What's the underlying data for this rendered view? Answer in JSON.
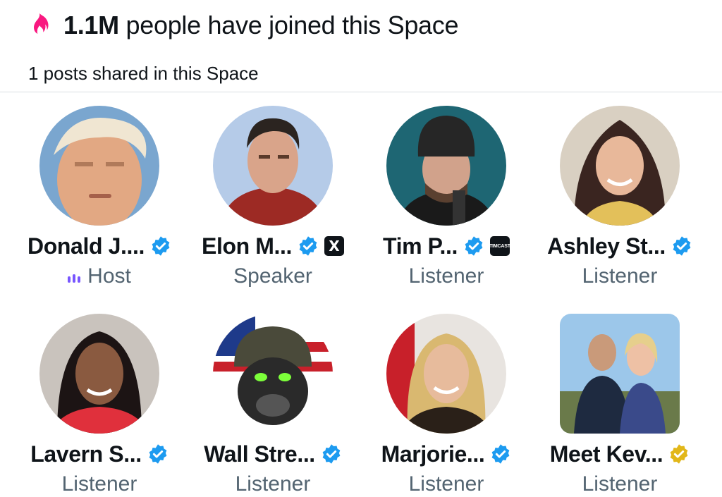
{
  "header": {
    "count": "1.1M",
    "joined_text": "people have joined this Space",
    "posts_text": "1 posts shared in this Space"
  },
  "colors": {
    "flame": "#f91880",
    "verified_blue": "#1d9bf0",
    "verified_gold": "#e2b719",
    "host_purple": "#7856ff",
    "role_gray": "#536471"
  },
  "participants": [
    {
      "name": "Donald J....",
      "role": "Host",
      "badge": "verified-blue",
      "affiliation": null
    },
    {
      "name": "Elon M...",
      "role": "Speaker",
      "badge": "verified-blue",
      "affiliation": "X"
    },
    {
      "name": "Tim P...",
      "role": "Listener",
      "badge": "verified-blue",
      "affiliation": "TIMCAST"
    },
    {
      "name": "Ashley St...",
      "role": "Listener",
      "badge": "verified-blue",
      "affiliation": null
    },
    {
      "name": "Lavern S...",
      "role": "Listener",
      "badge": "verified-blue",
      "affiliation": null
    },
    {
      "name": "Wall Stre...",
      "role": "Listener",
      "badge": "verified-blue",
      "affiliation": null
    },
    {
      "name": "Marjorie...",
      "role": "Listener",
      "badge": "verified-blue",
      "affiliation": null
    },
    {
      "name": "Meet Kev...",
      "role": "Listener",
      "badge": "verified-gold",
      "affiliation": null
    }
  ]
}
